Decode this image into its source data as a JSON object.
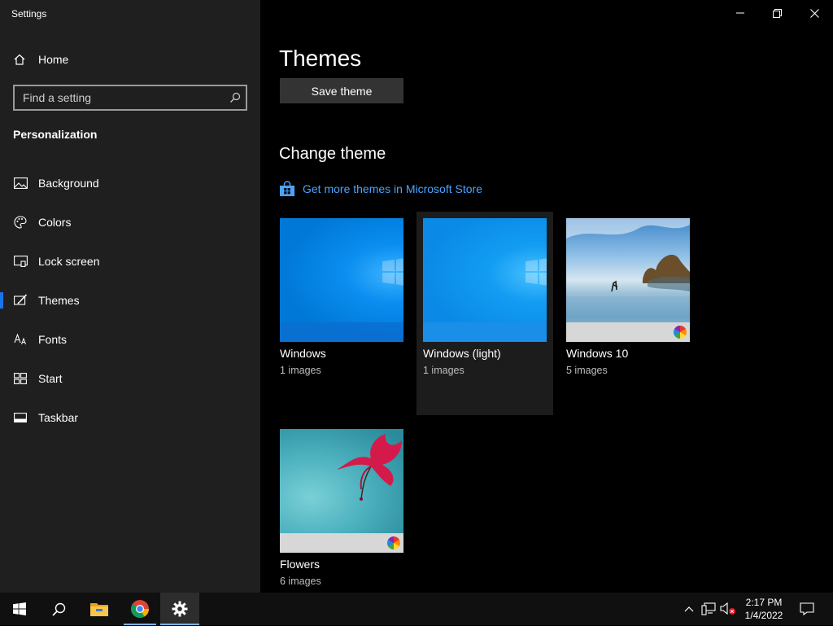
{
  "window": {
    "title": "Settings"
  },
  "sidebar": {
    "home_label": "Home",
    "search_placeholder": "Find a setting",
    "section_label": "Personalization",
    "items": [
      {
        "label": "Background",
        "icon": "picture-icon"
      },
      {
        "label": "Colors",
        "icon": "palette-icon"
      },
      {
        "label": "Lock screen",
        "icon": "lock-screen-icon"
      },
      {
        "label": "Themes",
        "icon": "brush-icon",
        "active": true
      },
      {
        "label": "Fonts",
        "icon": "fonts-icon"
      },
      {
        "label": "Start",
        "icon": "start-icon"
      },
      {
        "label": "Taskbar",
        "icon": "taskbar-icon"
      }
    ]
  },
  "main": {
    "title": "Themes",
    "save_label": "Save theme",
    "change_title": "Change theme",
    "store_link": "Get more themes in Microsoft Store",
    "themes": [
      {
        "name": "Windows",
        "count": "1 images"
      },
      {
        "name": "Windows (light)",
        "count": "1 images",
        "selected": true
      },
      {
        "name": "Windows 10",
        "count": "5 images"
      },
      {
        "name": "Flowers",
        "count": "6 images"
      }
    ]
  },
  "taskbar": {
    "apps": [
      "start-icon",
      "search-icon",
      "file-explorer-icon",
      "chrome-icon",
      "settings-icon"
    ],
    "tray": [
      "chevron-up-icon",
      "network-icon",
      "volume-muted-icon",
      "notification-icon"
    ],
    "time": "2:17 PM",
    "date": "1/4/2022"
  },
  "colors": {
    "accent": "#1a73e8",
    "link": "#4aa3ff",
    "sidebar_bg": "#1f1f1f",
    "main_bg": "#000000"
  }
}
